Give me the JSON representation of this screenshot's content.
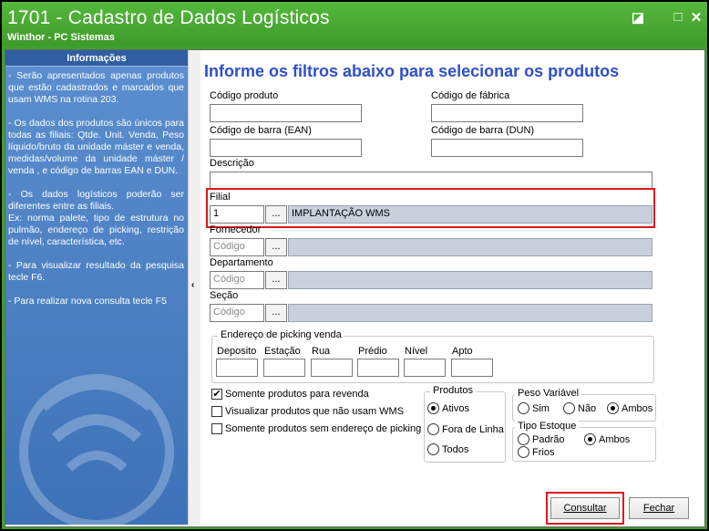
{
  "window": {
    "title": "1701 - Cadastro de Dados Logísticos",
    "subtitle": "Winthor - PC Sistemas",
    "restore_glyph": "◪",
    "maximize_glyph": "□",
    "close_glyph": "✕"
  },
  "info_panel": {
    "header": "Informações",
    "paragraphs": [
      "- Serão apresentados apenas produtos que estão cadastrados e marcados que usam WMS na rotina 203.",
      "- Os dados dos produtos são únicos para todas as filiais: Qtde. Unit. Venda, Peso líquido/bruto da unidade máster e venda, medidas/volume da unidade máster / venda , e código de barras EAN e DUN.",
      "- Os dados logísticos poderão ser diferentes entre as filiais.\nEx: norma palete, tipo de estrutura no pulmão, endereço de picking, restrição de nível, característica, etc.",
      "- Para visualizar resultado da pesquisa tecle F6.",
      "- Para realizar nova consulta tecle F5"
    ],
    "collapse_glyph": "‹"
  },
  "form": {
    "heading": "Informe os filtros abaixo para selecionar os produtos",
    "codigo_produto": {
      "label": "Código produto",
      "value": ""
    },
    "codigo_fabrica": {
      "label": "Código de fábrica",
      "value": ""
    },
    "codigo_barra_ean": {
      "label": "Código de barra (EAN)",
      "value": ""
    },
    "codigo_barra_dun": {
      "label": "Código de barra (DUN)",
      "value": ""
    },
    "descricao": {
      "label": "Descrição",
      "value": ""
    },
    "filial": {
      "label": "Filial",
      "code": "1",
      "name": "IMPLANTAÇÃO WMS",
      "lookup": "..."
    },
    "fornecedor": {
      "label": "Fornecedor",
      "placeholder": "Código",
      "name": "",
      "lookup": "..."
    },
    "departamento": {
      "label": "Departamento",
      "placeholder": "Código",
      "name": "",
      "lookup": "..."
    },
    "secao": {
      "label": "Seção",
      "placeholder": "Código",
      "name": "",
      "lookup": "..."
    },
    "picking": {
      "title": "Endereço de picking venda",
      "fields": [
        "Deposito",
        "Estação",
        "Rua",
        "Prédio",
        "Nível",
        "Apto"
      ]
    },
    "checkboxes": [
      {
        "label": "Somente produtos para revenda",
        "checked": true
      },
      {
        "label": "Visualizar produtos que não usam WMS",
        "checked": false
      },
      {
        "label": "Somente produtos sem endereço de picking",
        "checked": false
      }
    ],
    "produtos": {
      "title": "Produtos",
      "options": [
        {
          "label": "Ativos",
          "selected": true
        },
        {
          "label": "Fora de Linha",
          "selected": false
        },
        {
          "label": "Todos",
          "selected": false
        }
      ]
    },
    "peso_variavel": {
      "title": "Peso Variável",
      "options": [
        {
          "label": "Sim",
          "selected": false
        },
        {
          "label": "Não",
          "selected": false
        },
        {
          "label": "Ambos",
          "selected": true
        }
      ]
    },
    "tipo_estoque": {
      "title": "Tipo Estoque",
      "options": [
        {
          "label": "Padrão",
          "selected": false
        },
        {
          "label": "Ambos",
          "selected": true
        },
        {
          "label": "Frios",
          "selected": false
        }
      ]
    },
    "check_mark": "✔"
  },
  "buttons": {
    "consultar": "Consultar",
    "fechar": "Fechar"
  },
  "colors": {
    "title_bar": "#3fa02c",
    "heading": "#2e4fc9",
    "highlight": "#e0161d",
    "info_panel": "#4a7ec3"
  }
}
